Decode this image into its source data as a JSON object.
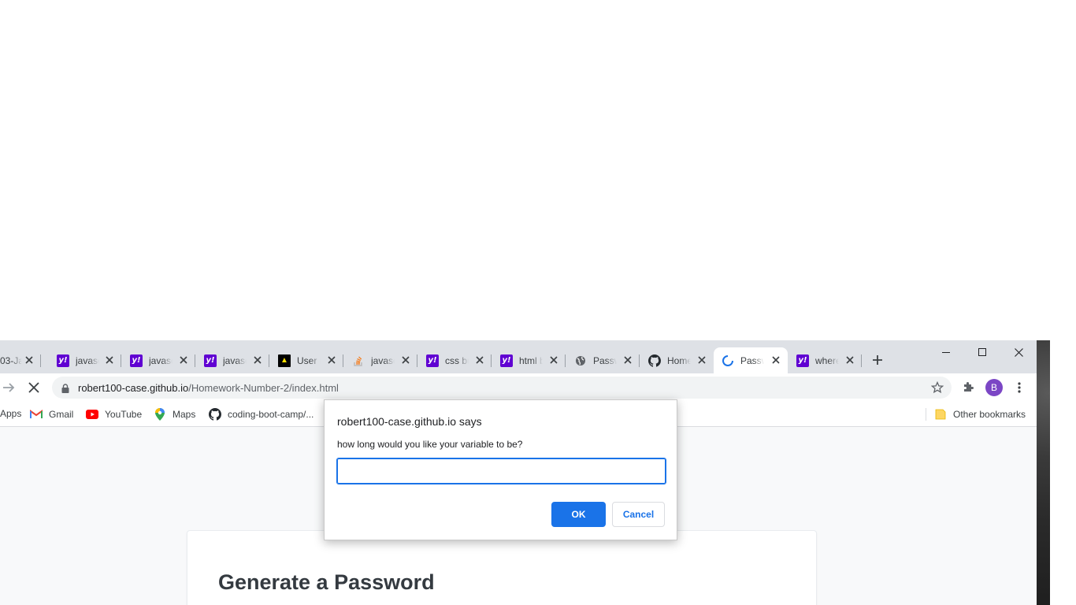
{
  "browser": {
    "tabs": [
      {
        "title": "03-Ja",
        "favicon": "none",
        "active": false
      },
      {
        "title": "javasc",
        "favicon": "yahoo-icon",
        "active": false
      },
      {
        "title": "javasc",
        "favicon": "yahoo-icon",
        "active": false
      },
      {
        "title": "javasc",
        "favicon": "yahoo-icon",
        "active": false
      },
      {
        "title": "User I",
        "favicon": "keyhole-icon",
        "active": false
      },
      {
        "title": "javasc",
        "favicon": "stackoverflow-icon",
        "active": false
      },
      {
        "title": "css bu",
        "favicon": "yahoo-icon",
        "active": false
      },
      {
        "title": "html b",
        "favicon": "yahoo-icon",
        "active": false
      },
      {
        "title": "Passw",
        "favicon": "globe-icon",
        "active": false
      },
      {
        "title": "Home",
        "favicon": "github-icon",
        "active": false
      },
      {
        "title": "Passw",
        "favicon": "loading-spinner-icon",
        "active": true
      },
      {
        "title": "where",
        "favicon": "yahoo-icon",
        "active": false
      }
    ],
    "url": {
      "host": "robert100-case.github.io",
      "path": "/Homework-Number-2/index.html"
    },
    "profile_initial": "B",
    "bookmarks": {
      "apps": "Apps",
      "items": [
        "Gmail",
        "YouTube",
        "Maps",
        "coding-boot-camp/..."
      ],
      "other": "Other bookmarks"
    }
  },
  "page": {
    "heading": "Generate a Password"
  },
  "dialog": {
    "title": "robert100-case.github.io says",
    "message": "how long would you like your variable to be?",
    "input_value": "",
    "ok_label": "OK",
    "cancel_label": "Cancel"
  },
  "colors": {
    "accent": "#1a73e8",
    "yahoo": "#6001d2",
    "profile": "#7b46c5"
  }
}
